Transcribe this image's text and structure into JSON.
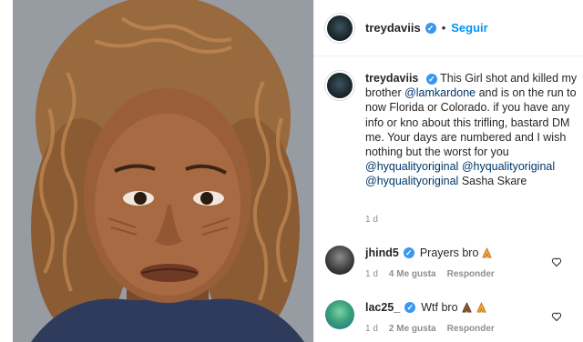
{
  "header": {
    "username": "treydaviis",
    "follow_label": "Seguir",
    "separator": "•"
  },
  "caption": {
    "username": "treydaviis",
    "part1": "This Girl shot and killed my brother ",
    "mention1": "@lamkardone",
    "part2": " and is on the run to now Florida or Colorado. if you have any info or kno about this trifling, bastard DM me. Your days are numbered and I wish nothing but the worst for you ",
    "mention2": "@hyqualityoriginal",
    "mention3": "@hyqualityoriginal",
    "mention4": "@hyqualityoriginal",
    "part3": "Sasha Skare",
    "time": "1 d"
  },
  "comments": [
    {
      "username": "jhind5",
      "text": "Prayers bro",
      "time": "1 d",
      "likes": "4 Me gusta",
      "reply": "Responder",
      "emoji": "folded-hands"
    },
    {
      "username": "lac25_",
      "text": "Wtf bro",
      "time": "1 d",
      "likes": "2 Me gusta",
      "reply": "Responder",
      "emoji": "folded-hands"
    }
  ],
  "colors": {
    "verified": "#3897f0",
    "follow": "#0095f6",
    "mention": "#00376b",
    "meta": "#8e8e8e"
  }
}
